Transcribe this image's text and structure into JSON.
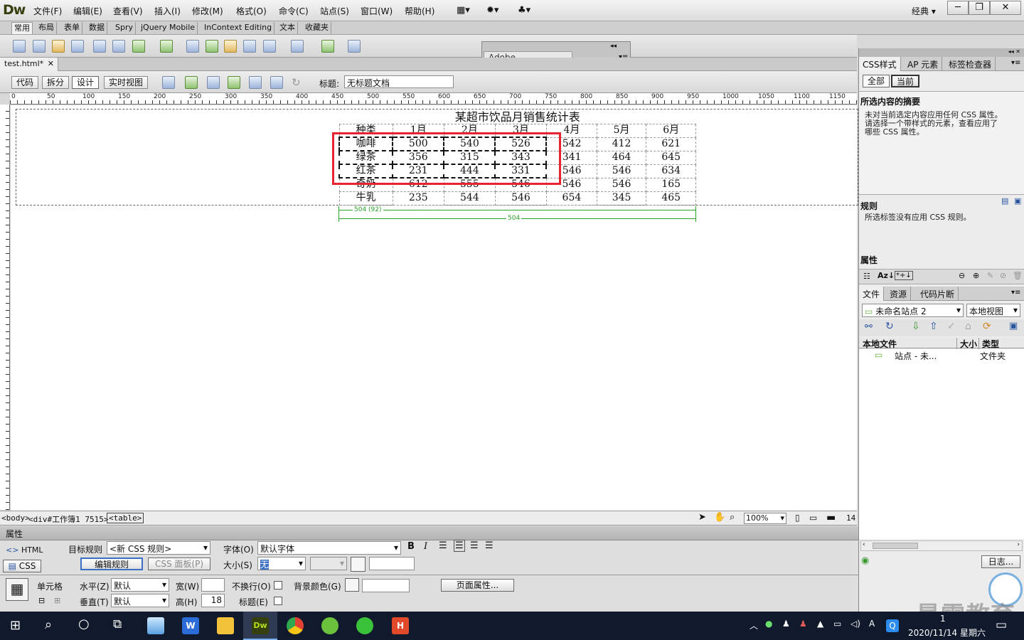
{
  "app": {
    "logo": "Dw"
  },
  "menu": [
    "文件(F)",
    "编辑(E)",
    "查看(V)",
    "插入(I)",
    "修改(M)",
    "格式(O)",
    "命令(C)",
    "站点(S)",
    "窗口(W)",
    "帮助(H)"
  ],
  "workspace": "经典",
  "insert_tabs": [
    "常用",
    "布局",
    "表单",
    "数据",
    "Spry",
    "jQuery Mobile",
    "InContext Editing",
    "文本",
    "收藏夹"
  ],
  "browserlab": "Adobe BrowserLab",
  "doc_tab": "test.html*",
  "views": [
    "代码",
    "拆分",
    "设计",
    "实时视图"
  ],
  "title_label": "标题:",
  "title_value": "无标题文档",
  "ruler_labels": [
    "0",
    "50",
    "100",
    "150",
    "200",
    "250",
    "300",
    "350",
    "400",
    "450",
    "500",
    "550",
    "600",
    "650",
    "700",
    "750",
    "800",
    "850",
    "900",
    "950",
    "1000",
    "1050",
    "1100",
    "1150"
  ],
  "table": {
    "caption": "某超市饮品月销售统计表",
    "header": [
      "种类",
      "1月",
      "2月",
      "3月",
      "4月",
      "5月",
      "6月"
    ],
    "rows": [
      [
        "咖啡",
        "500",
        "540",
        "526",
        "542",
        "412",
        "621"
      ],
      [
        "绿茶",
        "356",
        "315",
        "343",
        "341",
        "464",
        "645"
      ],
      [
        "红茶",
        "231",
        "444",
        "331",
        "546",
        "546",
        "634"
      ],
      [
        "奇奶",
        "612",
        "555",
        "546",
        "546",
        "546",
        "165"
      ],
      [
        "牛乳",
        "235",
        "544",
        "546",
        "654",
        "345",
        "465"
      ]
    ]
  },
  "measure": {
    "col": "504 (92)",
    "table": "504"
  },
  "statusbar": {
    "body": "<body>",
    "div": "<div#工作簿1 7515>",
    "table": "<table>",
    "zoom": "100%",
    "extra": "14"
  },
  "props": {
    "title": "属性",
    "html": "HTML",
    "css": "CSS",
    "target_label": "目标规则",
    "target_value": "<新 CSS 规则>",
    "edit_rule": "编辑规则",
    "css_panel": "CSS 面板(P)",
    "font_label": "字体(O)",
    "font_value": "默认字体",
    "size_label": "大小(S)",
    "size_value": "无",
    "cell_label": "单元格",
    "h_label": "水平(Z)",
    "h_value": "默认",
    "v_label": "垂直(T)",
    "v_value": "默认",
    "w_label": "宽(W)",
    "height_label": "高(H)",
    "height_value": "18",
    "nowrap_label": "不换行(O)",
    "header_label": "标题(E)",
    "bg_label": "背景颜色(G)",
    "page_props": "页面属性..."
  },
  "right_panel": {
    "tabs": [
      "CSS样式",
      "AP 元素",
      "标签检查器"
    ],
    "subtabs": [
      "全部",
      "当前"
    ],
    "summary_title": "所选内容的摘要",
    "summary_text": [
      "未对当前选定内容应用任何 CSS 属性。",
      "请选择一个带样式的元素，查看应用了",
      "哪些 CSS 属性。"
    ],
    "rules_title": "规则",
    "rules_text": "所选标签没有应用 CSS 规则。",
    "props_title": "属性",
    "file_tabs": [
      "文件",
      "资源",
      "代码片断"
    ],
    "site": "未命名站点 2",
    "view": "本地视图",
    "cols": [
      "本地文件",
      "大小",
      "类型"
    ],
    "file_name": "站点 - 未...",
    "file_type": "文件夹",
    "log": "日志..."
  },
  "taskbar": {
    "time": "1",
    "date": "2020/11/14 星期六",
    "ime": "A"
  },
  "watermark": "最需教育",
  "colors": {
    "selection": "#e8222e",
    "measure": "#27a327",
    "taskbar": "#101a2c"
  }
}
